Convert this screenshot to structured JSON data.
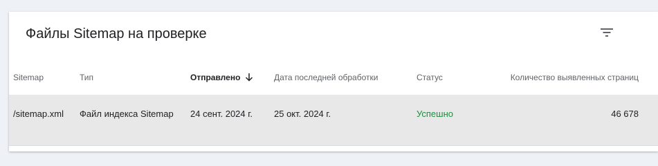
{
  "panel": {
    "title": "Файлы Sitemap на проверке",
    "filter_icon": "filter-icon"
  },
  "table": {
    "columns": [
      {
        "label": "Sitemap",
        "sorted": false
      },
      {
        "label": "Тип",
        "sorted": false
      },
      {
        "label": "Отправлено",
        "sorted": true,
        "sort_direction": "descending"
      },
      {
        "label": "Дата последней обработки",
        "sorted": false
      },
      {
        "label": "Статус",
        "sorted": false
      },
      {
        "label": "Количество выявленных страниц",
        "sorted": false
      }
    ],
    "rows": [
      {
        "sitemap": "/sitemap.xml",
        "type": "Файл индекса Sitemap",
        "submitted": "24 сент. 2024 г.",
        "last_processed": "25 окт. 2024 г.",
        "status": "Успешно",
        "discovered_pages": "46 678"
      }
    ]
  },
  "colors": {
    "status_success": "#1e8e3e",
    "selected_row": "#e8e8e8"
  }
}
